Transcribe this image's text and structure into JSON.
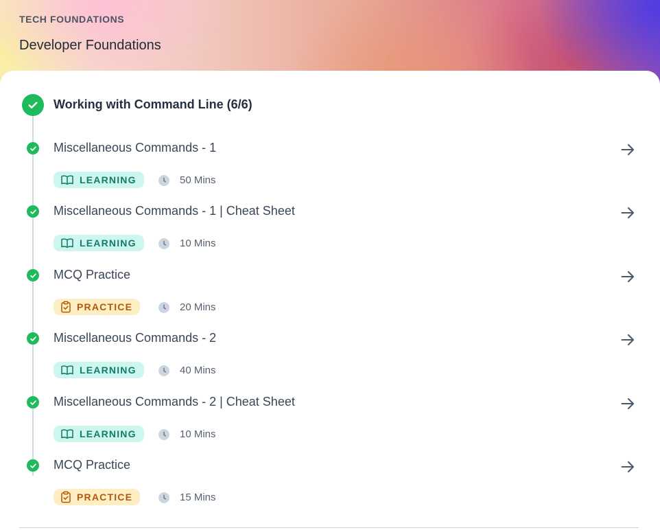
{
  "header": {
    "eyebrow": "TECH FOUNDATIONS",
    "title": "Developer Foundations"
  },
  "module": {
    "title": "Working with Command Line (6/6)",
    "status": "completed"
  },
  "items": [
    {
      "title": "Miscellaneous Commands - 1",
      "badge": "LEARNING",
      "type": "learning",
      "duration": "50 Mins",
      "status": "completed"
    },
    {
      "title": "Miscellaneous Commands - 1 | Cheat Sheet",
      "badge": "LEARNING",
      "type": "learning",
      "duration": "10 Mins",
      "status": "completed"
    },
    {
      "title": "MCQ Practice",
      "badge": "PRACTICE",
      "type": "practice",
      "duration": "20 Mins",
      "status": "completed"
    },
    {
      "title": "Miscellaneous Commands - 2",
      "badge": "LEARNING",
      "type": "learning",
      "duration": "40 Mins",
      "status": "completed"
    },
    {
      "title": "Miscellaneous Commands - 2 | Cheat Sheet",
      "badge": "LEARNING",
      "type": "learning",
      "duration": "10 Mins",
      "status": "completed"
    },
    {
      "title": "MCQ Practice",
      "badge": "PRACTICE",
      "type": "practice",
      "duration": "15 Mins",
      "status": "completed"
    }
  ],
  "icons": {
    "check": "check-icon",
    "arrow": "arrow-right-icon",
    "learning": "book-open-icon",
    "practice": "clipboard-check-icon",
    "duration": "clock-icon"
  },
  "colors": {
    "success": "#1fba5c",
    "learning_bg": "#cdf6ef",
    "learning_text": "#147a6c",
    "practice_bg": "#fdefc3",
    "practice_text": "#b2580b",
    "timeline": "#cfd8e3"
  }
}
